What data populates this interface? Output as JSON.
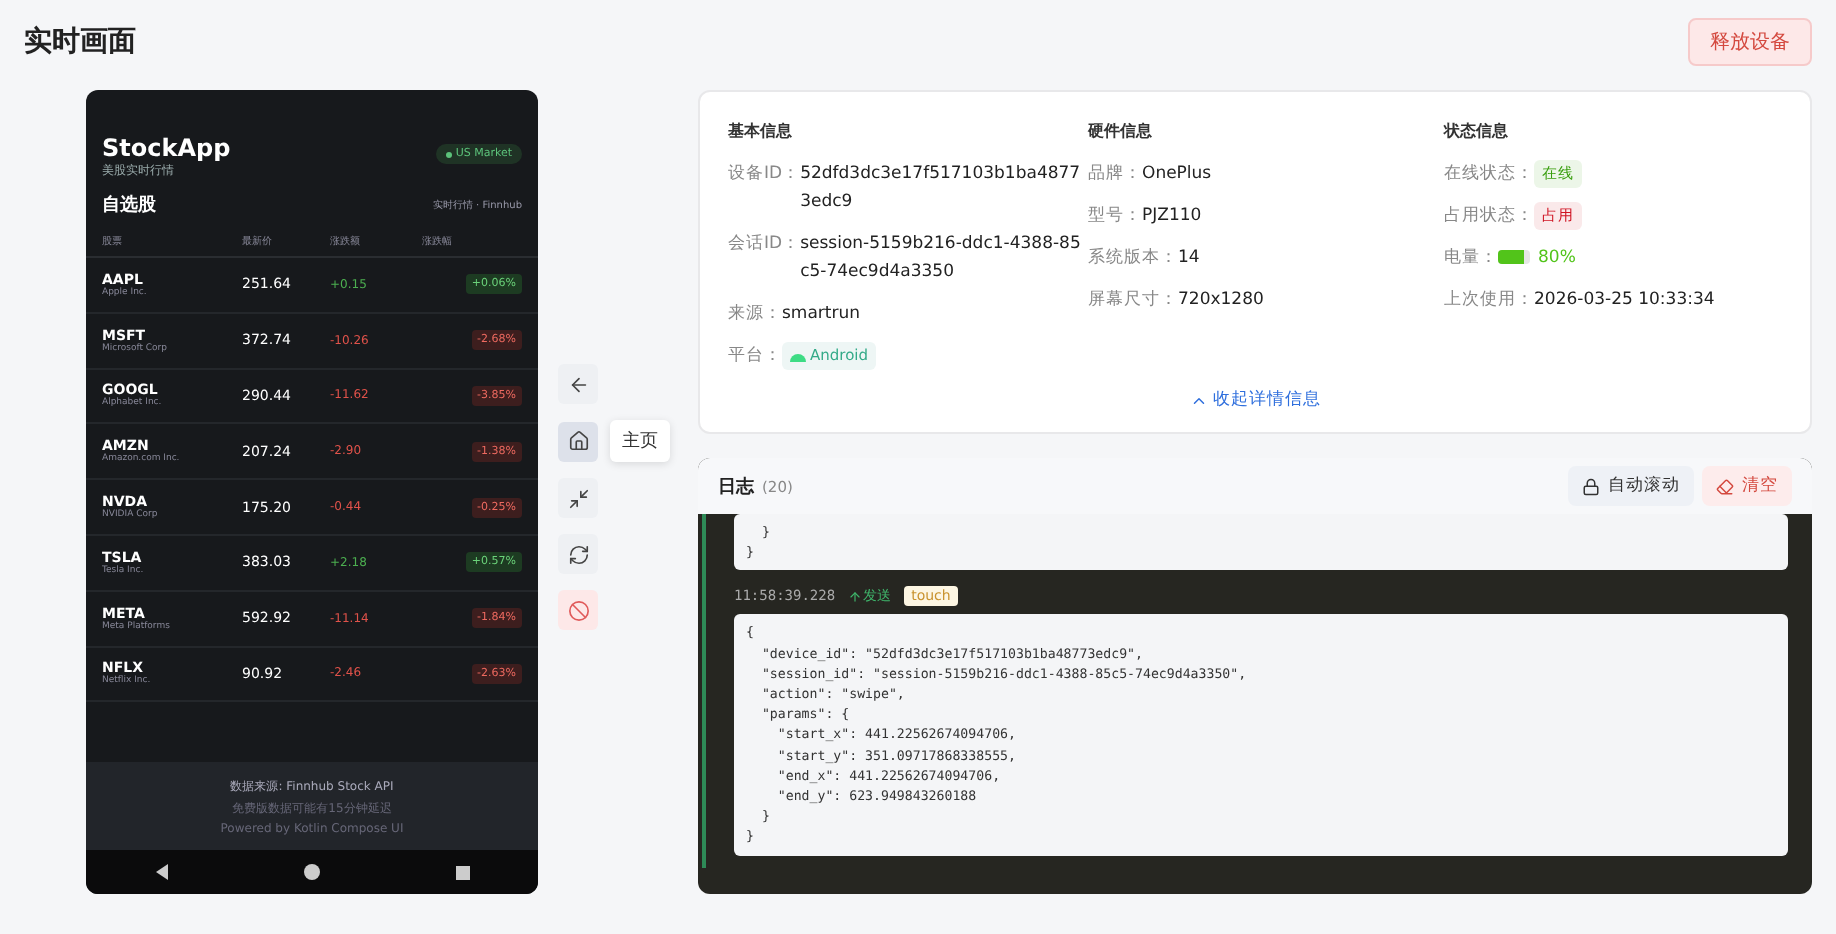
{
  "page": {
    "title": "实时画面",
    "release_button": "释放设备"
  },
  "phone": {
    "app_title": "StockApp",
    "subtitle": "美股实时行情",
    "market_badge": "US Market",
    "section_title": "自选股",
    "source_label": "实时行情 · Finnhub",
    "columns": [
      "股票",
      "最新价",
      "涨跌额",
      "涨跌幅"
    ],
    "stocks": [
      {
        "symbol": "AAPL",
        "name": "Apple Inc.",
        "price": "251.64",
        "change": "+0.15",
        "percent": "+0.06%",
        "kind": "up"
      },
      {
        "symbol": "MSFT",
        "name": "Microsoft Corp",
        "price": "372.74",
        "change": "-10.26",
        "percent": "-2.68%",
        "kind": "down"
      },
      {
        "symbol": "GOOGL",
        "name": "Alphabet Inc.",
        "price": "290.44",
        "change": "-11.62",
        "percent": "-3.85%",
        "kind": "down"
      },
      {
        "symbol": "AMZN",
        "name": "Amazon.com Inc.",
        "price": "207.24",
        "change": "-2.90",
        "percent": "-1.38%",
        "kind": "down"
      },
      {
        "symbol": "NVDA",
        "name": "NVIDIA Corp",
        "price": "175.20",
        "change": "-0.44",
        "percent": "-0.25%",
        "kind": "down"
      },
      {
        "symbol": "TSLA",
        "name": "Tesla Inc.",
        "price": "383.03",
        "change": "+2.18",
        "percent": "+0.57%",
        "kind": "up"
      },
      {
        "symbol": "META",
        "name": "Meta Platforms",
        "price": "592.92",
        "change": "-11.14",
        "percent": "-1.84%",
        "kind": "down"
      },
      {
        "symbol": "NFLX",
        "name": "Netflix Inc.",
        "price": "90.92",
        "change": "-2.46",
        "percent": "-2.63%",
        "kind": "down"
      }
    ],
    "footer": [
      "数据来源: Finnhub Stock API",
      "免费版数据可能有15分钟延迟",
      "Powered by Kotlin Compose UI"
    ]
  },
  "controls": [
    {
      "kind": "back",
      "selected": false
    },
    {
      "kind": "home",
      "selected": true,
      "tooltip": "主页"
    },
    {
      "kind": "fullscreen",
      "selected": false
    },
    {
      "kind": "rotate",
      "selected": false
    },
    {
      "kind": "stop",
      "selected": false
    }
  ],
  "info": {
    "sections": [
      {
        "title": "基本信息",
        "fields": [
          {
            "label": "设备ID：",
            "kind": "text",
            "value": "52dfd3dc3e17f517103b1ba48773edc9"
          },
          {
            "label": "会话ID：",
            "kind": "text",
            "value": "session-5159b216-ddc1-4388-85c5-74ec9d4a3350"
          },
          {
            "label": "来源：",
            "kind": "text",
            "value": "smartrun"
          },
          {
            "label": "平台：",
            "kind": "platform",
            "value": "Android"
          }
        ]
      },
      {
        "title": "硬件信息",
        "fields": [
          {
            "label": "品牌：",
            "kind": "text",
            "value": "OnePlus"
          },
          {
            "label": "型号：",
            "kind": "text",
            "value": "PJZ110"
          },
          {
            "label": "系统版本：",
            "kind": "text",
            "value": "14"
          },
          {
            "label": "屏幕尺寸：",
            "kind": "text",
            "value": "720x1280"
          }
        ]
      },
      {
        "title": "状态信息",
        "fields": [
          {
            "label": "在线状态：",
            "kind": "tag",
            "value": "在线",
            "color": "#389e0d"
          },
          {
            "label": "占用状态：",
            "kind": "tag",
            "value": "占用",
            "color": "#cf1322"
          },
          {
            "label": "电量：",
            "kind": "battery",
            "value": "80%",
            "level": 0.8
          },
          {
            "label": "上次使用：",
            "kind": "text",
            "value": "2026-03-25 10:33:34"
          }
        ]
      }
    ],
    "collapse_link": "收起详情信息"
  },
  "log": {
    "title": "日志",
    "count": "(20)",
    "auto_scroll_button": "自动滚动",
    "clear_button": "清空",
    "entries": [
      {
        "kind": "tail",
        "code": "  }\n}"
      },
      {
        "kind": "entry",
        "time": "11:58:39.228",
        "direction": "发送",
        "tag": "touch",
        "code": "{\n  \"device_id\": \"52dfd3dc3e17f517103b1ba48773edc9\",\n  \"session_id\": \"session-5159b216-ddc1-4388-85c5-74ec9d4a3350\",\n  \"action\": \"swipe\",\n  \"params\": {\n    \"start_x\": 441.22562674094706,\n    \"start_y\": 351.09717868338555,\n    \"end_x\": 441.22562674094706,\n    \"end_y\": 623.949843260188\n  }\n}"
      }
    ]
  }
}
